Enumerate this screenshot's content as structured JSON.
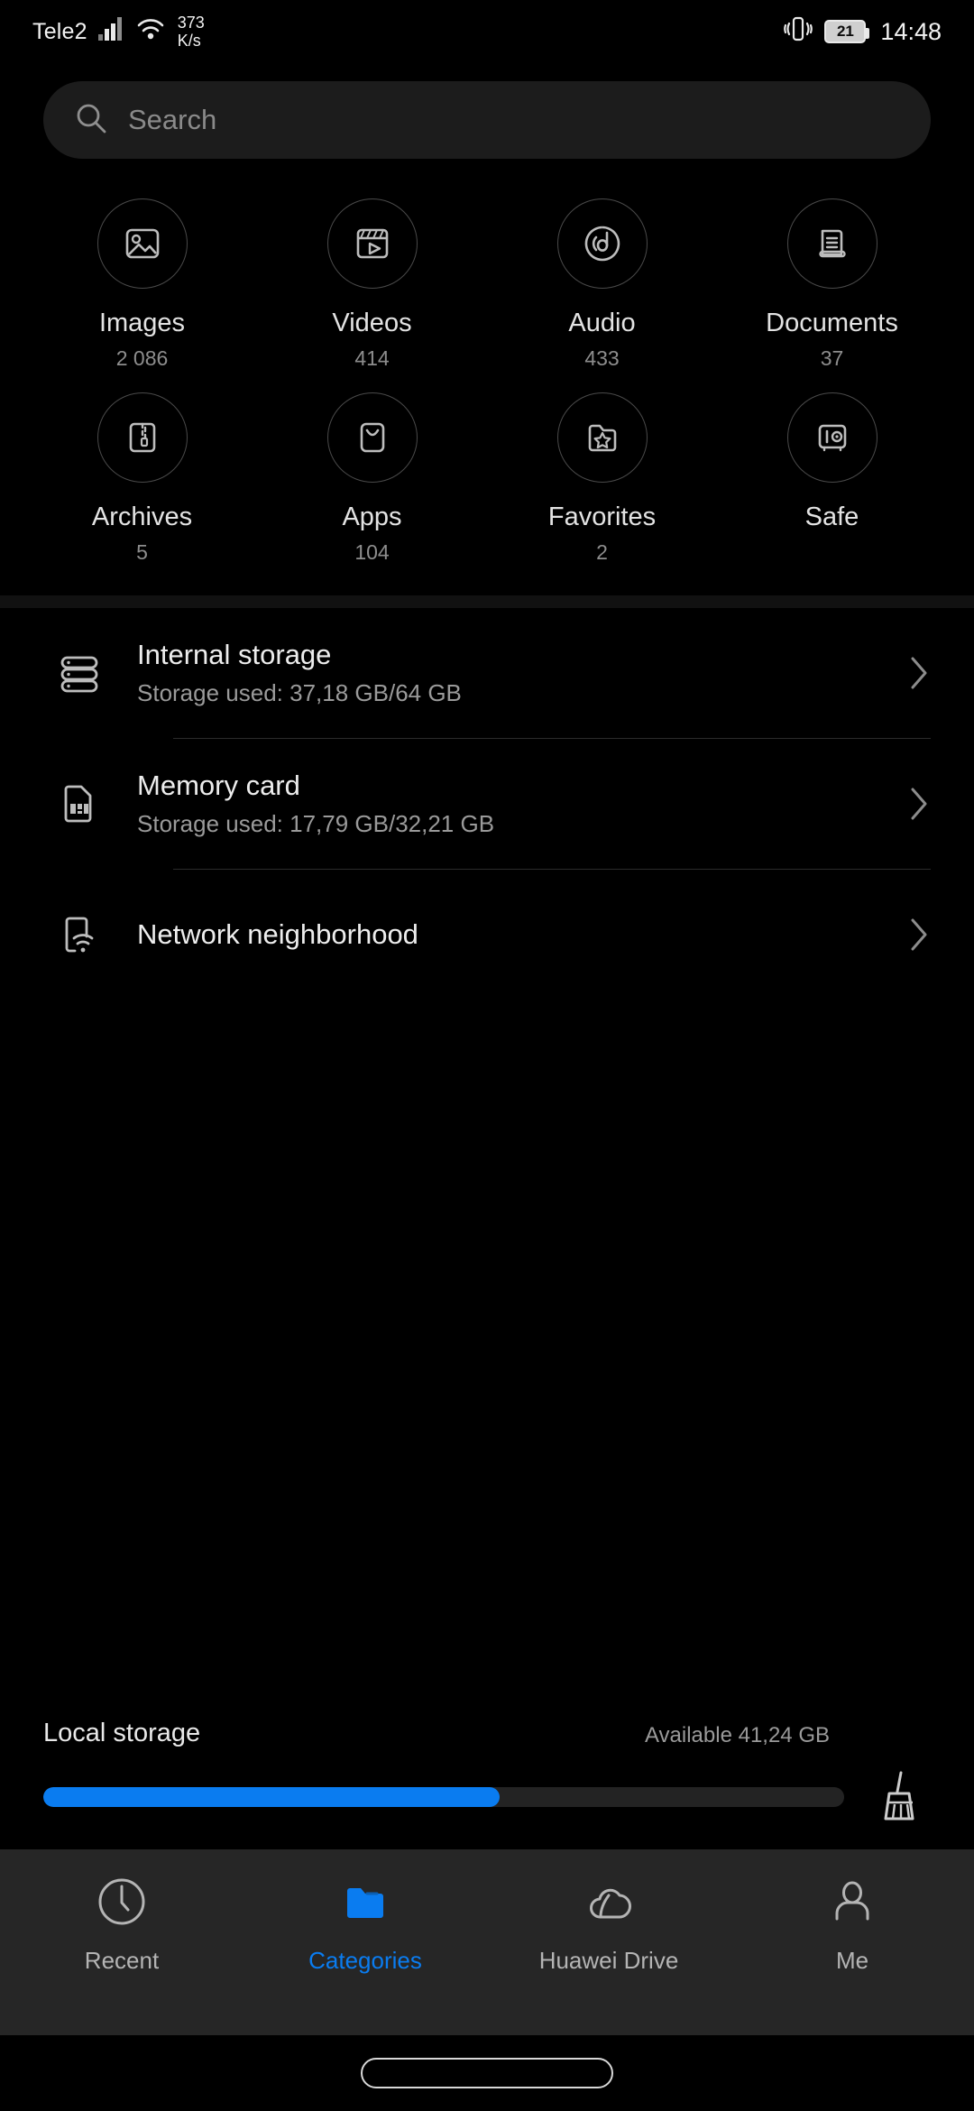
{
  "status_bar": {
    "carrier": "Tele2",
    "network_speed_value": "373",
    "network_speed_unit": "K/s",
    "battery_percent": "21",
    "time": "14:48",
    "icons": [
      "signal-bars-icon",
      "wifi-icon",
      "vibrate-icon",
      "battery-icon"
    ]
  },
  "search": {
    "placeholder": "Search",
    "value": "",
    "icon": "search-icon"
  },
  "categories": [
    {
      "label": "Images",
      "count": "2 086",
      "icon": "image-icon"
    },
    {
      "label": "Videos",
      "count": "414",
      "icon": "video-clapperboard-icon"
    },
    {
      "label": "Audio",
      "count": "433",
      "icon": "music-note-disc-icon"
    },
    {
      "label": "Documents",
      "count": "37",
      "icon": "document-scroll-icon"
    },
    {
      "label": "Archives",
      "count": "5",
      "icon": "zip-archive-icon"
    },
    {
      "label": "Apps",
      "count": "104",
      "icon": "app-bag-icon"
    },
    {
      "label": "Favorites",
      "count": "2",
      "icon": "folder-star-icon"
    },
    {
      "label": "Safe",
      "count": "",
      "icon": "safe-vault-icon"
    }
  ],
  "storage_rows": [
    {
      "title": "Internal storage",
      "subtitle": "Storage used: 37,18 GB/64 GB",
      "icon": "internal-storage-icon",
      "chevron": "chevron-right-icon"
    },
    {
      "title": "Memory card",
      "subtitle": "Storage used: 17,79 GB/32,21 GB",
      "icon": "memory-card-icon",
      "chevron": "chevron-right-icon"
    },
    {
      "title": "Network neighborhood",
      "subtitle": "",
      "icon": "network-neighborhood-icon",
      "chevron": "chevron-right-icon"
    }
  ],
  "local_storage": {
    "title": "Local storage",
    "available": "Available 41,24 GB",
    "used_percent": 57,
    "bar_color": "#0a7cf0",
    "cleanup_icon": "broom-cleanup-icon"
  },
  "bottom_nav": {
    "items": [
      {
        "label": "Recent",
        "icon": "clock-icon",
        "active": false
      },
      {
        "label": "Categories",
        "icon": "folder-icon",
        "active": true
      },
      {
        "label": "Huawei Drive",
        "icon": "cloud-icon",
        "active": false
      },
      {
        "label": "Me",
        "icon": "person-icon",
        "active": false
      }
    ],
    "active_color": "#0a7cf0"
  },
  "gesture_bar": {
    "name": "home-gesture-bar"
  }
}
